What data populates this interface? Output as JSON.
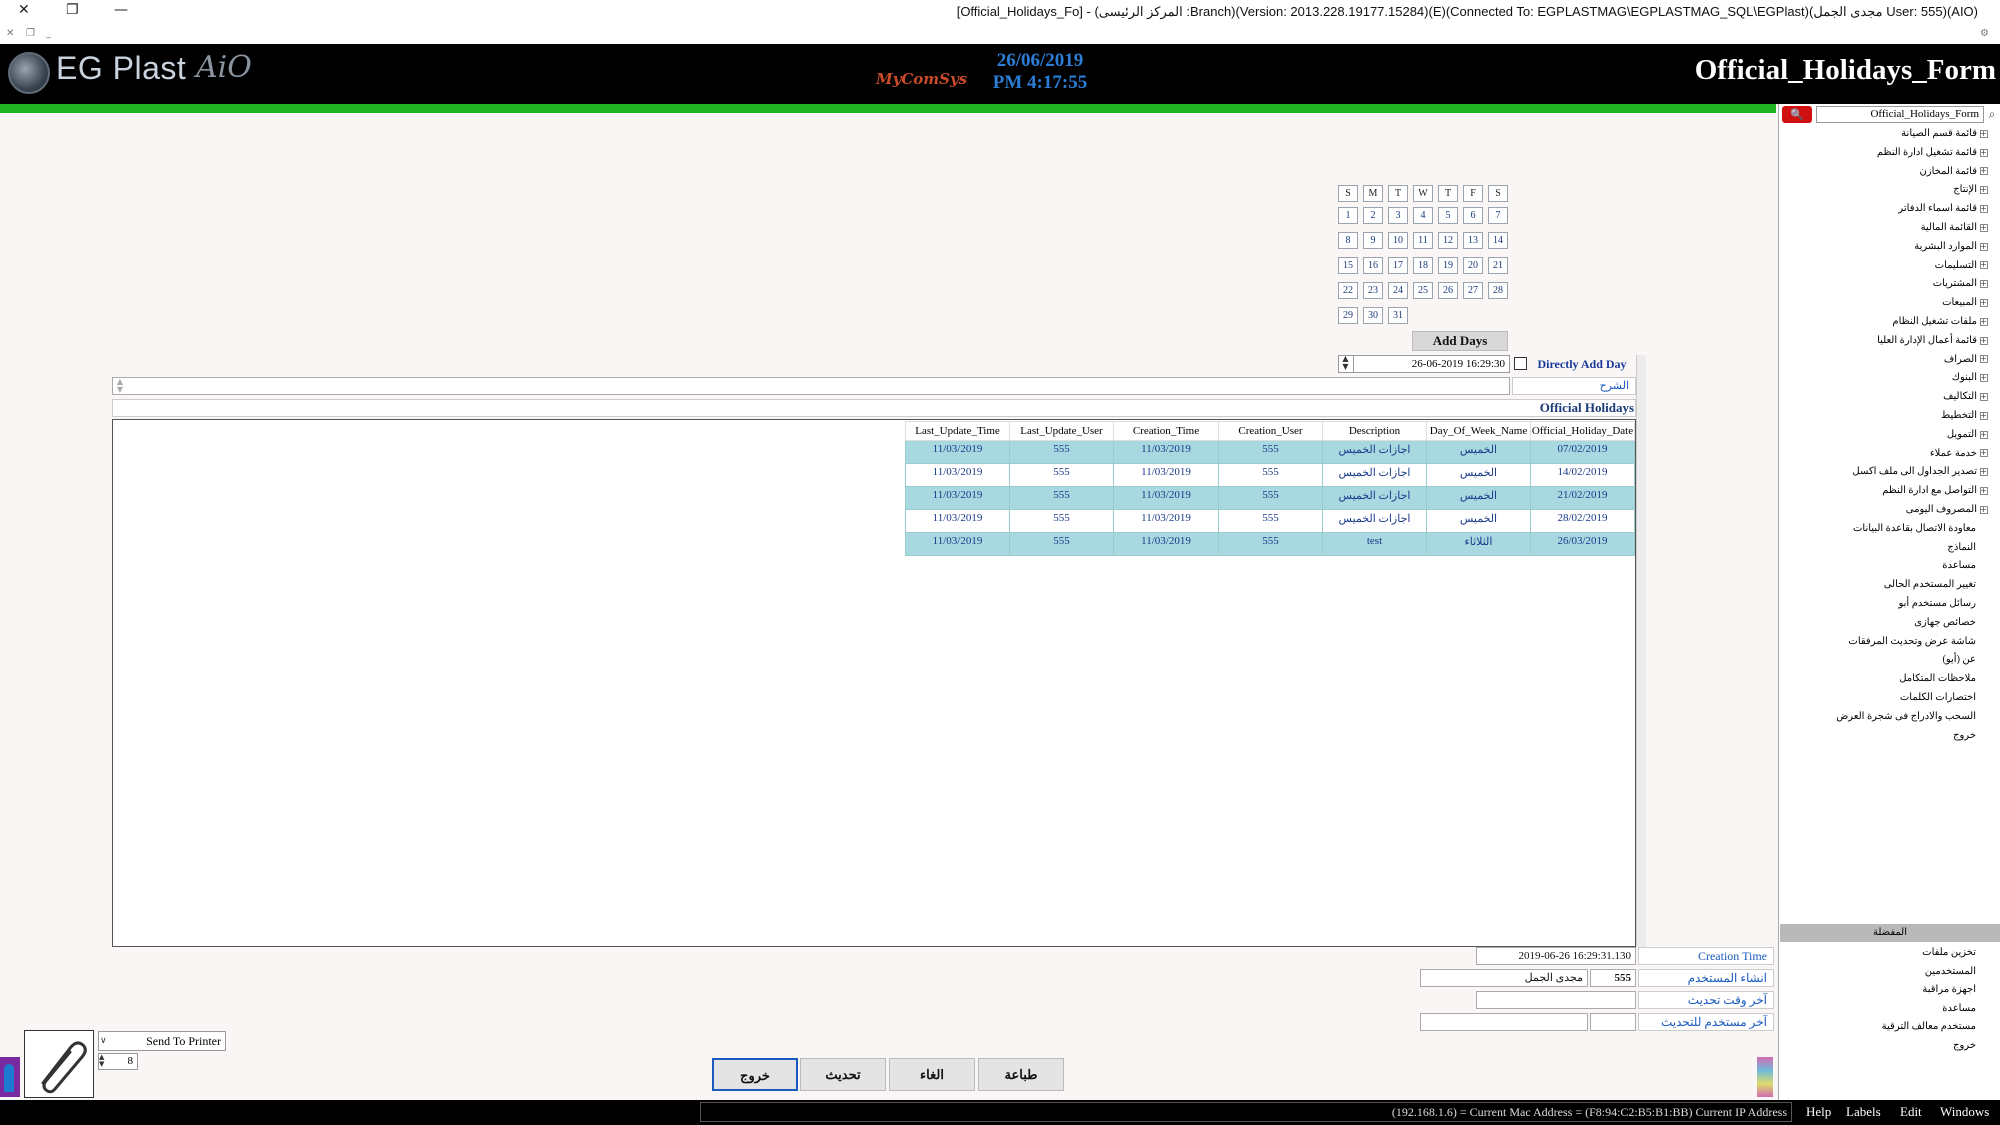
{
  "titlebar": {
    "title": "[Official_Holidays_Fo] - (المركز الرئيسى :Branch)(Version: 2013.228.19177.15284)(E)(Connected To: EGPLASTMAG\\EGPLASTMAG_SQL\\EGPlast)(مجدى الجمل User: 555)(AIO)"
  },
  "header": {
    "logo_text": "EG Plast",
    "logo_suffix": "AiO",
    "brand": "MyComSys",
    "date": "26/06/2019",
    "time": "PM 4:17:55",
    "form_title": "Official_Holidays_Form"
  },
  "sidebar": {
    "search_value": "Official_Holidays_Form",
    "tree": [
      {
        "label": "قائمة قسم الصيانة",
        "expandable": true
      },
      {
        "label": "قائمة تشغيل ادارة النظم",
        "expandable": true
      },
      {
        "label": "قائمة المخازن",
        "expandable": true
      },
      {
        "label": "الإنتاج",
        "expandable": true
      },
      {
        "label": "قائمة اسماء الدفاتر",
        "expandable": true
      },
      {
        "label": "القائمة المالية",
        "expandable": true
      },
      {
        "label": "الموارد البشرية",
        "expandable": true
      },
      {
        "label": "التسليمات",
        "expandable": true
      },
      {
        "label": "المشتريات",
        "expandable": true
      },
      {
        "label": "المبيعات",
        "expandable": true
      },
      {
        "label": "ملفات تشغيل النظام",
        "expandable": true
      },
      {
        "label": "قائمة أعمال الإدارة العليا",
        "expandable": true
      },
      {
        "label": "الصراف",
        "expandable": true
      },
      {
        "label": "البنوك",
        "expandable": true
      },
      {
        "label": "التكاليف",
        "expandable": true
      },
      {
        "label": "التخطيط",
        "expandable": true
      },
      {
        "label": "التمويل",
        "expandable": true
      },
      {
        "label": "خدمة عملاء",
        "expandable": true
      },
      {
        "label": "تصدير الجداول الى ملف اكسل",
        "expandable": true
      },
      {
        "label": "التواصل مع ادارة النظم",
        "expandable": true
      },
      {
        "label": "المصروف اليومى",
        "expandable": true
      },
      {
        "label": "معاودة الاتصال بقاعدة البيانات",
        "expandable": false
      },
      {
        "label": "النماذج",
        "expandable": false
      },
      {
        "label": "مساعدة",
        "expandable": false
      },
      {
        "label": "تغيير المستخدم الحالى",
        "expandable": false
      },
      {
        "label": "رسائل مستخدم أبو",
        "expandable": false
      },
      {
        "label": "خصائص جهازى",
        "expandable": false
      },
      {
        "label": "شاشة عرض وتحديث المرفقات",
        "expandable": false
      },
      {
        "label": "عن (أيو)",
        "expandable": false
      },
      {
        "label": "ملاحظات المتكامل",
        "expandable": false
      },
      {
        "label": "اختصارات الكلمات",
        "expandable": false
      },
      {
        "label": "السحب والادراج فى شجرة العرض",
        "expandable": false
      },
      {
        "label": "خروج",
        "expandable": false
      }
    ],
    "favorites_header": "المفضلة",
    "favorites": [
      "تخزين ملفات",
      "المستخدمين",
      "اجهزة مراقبة",
      "مساعدة",
      "مستخدم معالف الترقية",
      "خروج"
    ]
  },
  "calendar": {
    "weekdays": [
      "S",
      "M",
      "T",
      "W",
      "T",
      "F",
      "S"
    ],
    "days": [
      "1",
      "2",
      "3",
      "4",
      "5",
      "6",
      "7",
      "8",
      "9",
      "10",
      "11",
      "12",
      "13",
      "14",
      "15",
      "16",
      "17",
      "18",
      "19",
      "20",
      "21",
      "22",
      "23",
      "24",
      "25",
      "26",
      "27",
      "28",
      "29",
      "30",
      "31"
    ],
    "add_days_label": "Add Days",
    "datetime_value": "26-06-2019 16:29:30",
    "direct_add_label": "Directly Add Day",
    "direct_add_checked": false
  },
  "form": {
    "description_label": "الشرح",
    "description_value": "",
    "grid_title": "Official Holidays"
  },
  "grid": {
    "columns": [
      "Last_Update_Time",
      "Last_Update_User",
      "Creation_Time",
      "Creation_User",
      "Description",
      "Day_Of_Week_Name",
      "Official_Holiday_Date"
    ],
    "rows": [
      [
        "11/03/2019",
        "555",
        "11/03/2019",
        "555",
        "اجازات الخميس",
        "الخميس",
        "07/02/2019"
      ],
      [
        "11/03/2019",
        "555",
        "11/03/2019",
        "555",
        "اجازات الخميس",
        "الخميس",
        "14/02/2019"
      ],
      [
        "11/03/2019",
        "555",
        "11/03/2019",
        "555",
        "اجازات الخميس",
        "الخميس",
        "21/02/2019"
      ],
      [
        "11/03/2019",
        "555",
        "11/03/2019",
        "555",
        "اجازات الخميس",
        "الخميس",
        "28/02/2019"
      ],
      [
        "11/03/2019",
        "555",
        "11/03/2019",
        "555",
        "test",
        "الثلاثاء",
        "26/03/2019"
      ]
    ]
  },
  "info": {
    "creation_time_label": "Creation Time",
    "creation_time_value": "2019-06-26 16:29:31.130",
    "creator_label": "انشاء المستخدم",
    "creator_id": "555",
    "creator_name": "مجدى الجمل",
    "last_update_time_label": "آخر وقت تحديث",
    "last_update_time_value": "",
    "last_update_user_label": "آخر مستخدم للتحديث",
    "last_update_user_id": "",
    "last_update_user_name": ""
  },
  "actions": {
    "exit": "خروج",
    "update": "تحديث",
    "cancel": "الغاء",
    "print": "طباعة"
  },
  "printer": {
    "selected": "Send To Printer",
    "copies": "8"
  },
  "statusbar": {
    "text": "(192.168.1.6) = Current Mac Address = (F8:94:C2:B5:B1:BB) Current IP Address",
    "menu": [
      "Help",
      "Labels",
      "Edit",
      "Windows"
    ]
  },
  "colors": {
    "header_bg": "#000000",
    "accent_green": "#22b322",
    "grid_row_highlight": "#a8d8e0",
    "label_blue": "#1a5abf",
    "search_red": "#d01010"
  }
}
